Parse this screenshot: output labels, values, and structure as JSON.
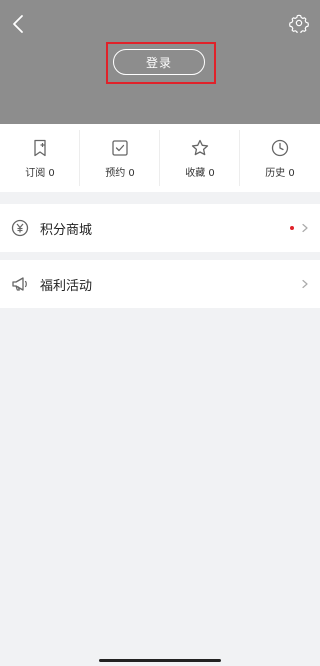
{
  "header": {
    "login_label": "登录",
    "background": "#8d8d8d",
    "highlight_color": "#e0222a"
  },
  "quick_actions": [
    {
      "label": "订阅 0",
      "icon": "bookmark-icon"
    },
    {
      "label": "预约 0",
      "icon": "checkbox-icon"
    },
    {
      "label": "收藏 0",
      "icon": "star-icon"
    },
    {
      "label": "历史 0",
      "icon": "clock-icon"
    }
  ],
  "menu": [
    {
      "label": "积分商城",
      "icon": "yen-coin-icon",
      "has_dot": true
    },
    {
      "label": "福利活动",
      "icon": "megaphone-icon",
      "has_dot": false
    }
  ]
}
